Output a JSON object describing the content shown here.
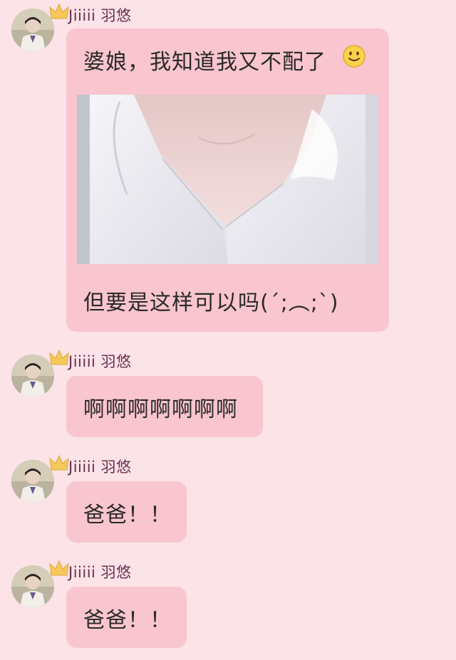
{
  "messages": [
    {
      "sender": "Jiiiii 羽悠",
      "text_top": "婆娘，我知道我又不配了",
      "emoji": "slightly-smiling-face-icon",
      "image": "photo-attachment",
      "text_bottom": "但要是这样可以吗(´;︵;`)"
    },
    {
      "sender": "Jiiiii 羽悠",
      "text": "啊啊啊啊啊啊啊"
    },
    {
      "sender": "Jiiiii 羽悠",
      "text": "爸爸！！"
    },
    {
      "sender": "Jiiiii 羽悠",
      "text": "爸爸！！"
    }
  ],
  "colors": {
    "background": "#fbe3e8",
    "bubble": "#f9c5ce",
    "sender_name": "#6c2f4e"
  }
}
